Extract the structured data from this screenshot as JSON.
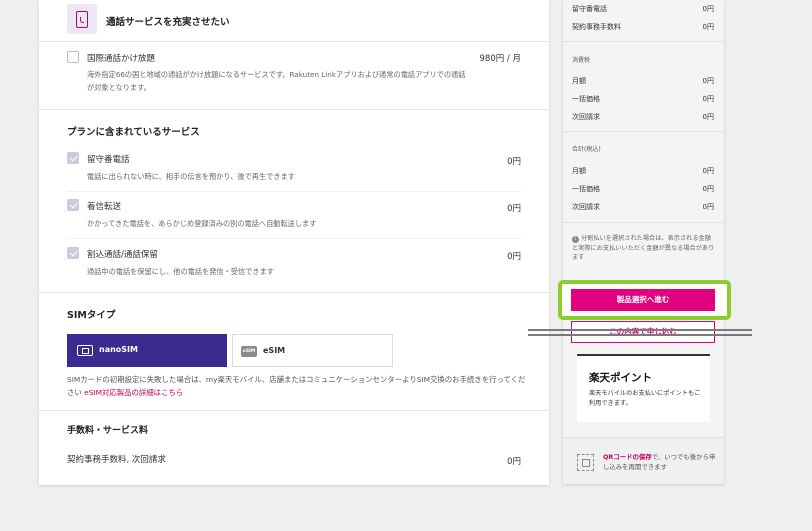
{
  "call_services": {
    "heading": "通話サービスを充実させたい",
    "items": [
      {
        "label": "国際通話かけ放題",
        "price": "980円 / 月",
        "desc": "海外指定66の国と地域の通話がかけ放題になるサービスです。Rakuten Linkアプリおよび通常の電話アプリでの通話が対象となります。",
        "checked": false
      }
    ]
  },
  "plan_services": {
    "heading": "プランに含まれているサービス",
    "items": [
      {
        "label": "留守番電話",
        "price": "0円",
        "desc": "電話に出られない時に、相手の伝言を預かり、後で再生できます",
        "checked": true
      },
      {
        "label": "着信転送",
        "price": "0円",
        "desc": "かかってきた電話を、あらかじめ登録済みの別の電話へ自動転送します",
        "checked": true
      },
      {
        "label": "割込通話/通話保留",
        "price": "0円",
        "desc": "通話中の電話を保留にし、他の電話を発信・受信できます",
        "checked": true
      }
    ]
  },
  "sim": {
    "heading": "SIMタイプ",
    "nano_label": "nanoSIM",
    "esim_label": "eSIM",
    "esim_badge": "eSIM",
    "note": "SIMカードの初期設定に失敗した場合は、my楽天モバイル、店舗またはコミュニケーションセンターよりSIM交換のお手続きを行ってください",
    "note_link": "eSIM対応製品の詳細はこちら",
    "selected": "nanoSIM"
  },
  "fees": {
    "heading": "手数料・サービス料",
    "label": "契約事務手数料, 次回請求",
    "price": "0円"
  },
  "summary": {
    "top_rows": [
      {
        "label": "留守番電話",
        "value": "0円"
      },
      {
        "label": "契約事務手数料",
        "value": "0円"
      }
    ],
    "tax_heading": "消費税",
    "tax_rows": [
      {
        "label": "月額",
        "value": "0円"
      },
      {
        "label": "一括価格",
        "value": "0円"
      },
      {
        "label": "次回請求",
        "value": "0円"
      }
    ],
    "total_heading": "合計(税込)",
    "total_rows": [
      {
        "label": "月額",
        "value": "0円"
      },
      {
        "label": "一括価格",
        "value": "0円"
      },
      {
        "label": "次回請求",
        "value": "0円"
      }
    ],
    "note": "分割払いを選択された場合は、表示される金額と実際にお支払いいただく金額が異なる場合があります",
    "primary_button": "製品選択へ進む",
    "secondary_button": "この内容で申し込む",
    "point_title": "楽天ポイント",
    "point_desc": "楽天モバイルのお支払いにポイントもご利用できます。",
    "qr_bold": "QRコードの保存",
    "qr_text": "で、いつでも後から申し込みを再開できます"
  },
  "colors": {
    "accent": "#e3007f",
    "sim_selected": "#3a2b91",
    "highlight": "#8ccc2b"
  }
}
